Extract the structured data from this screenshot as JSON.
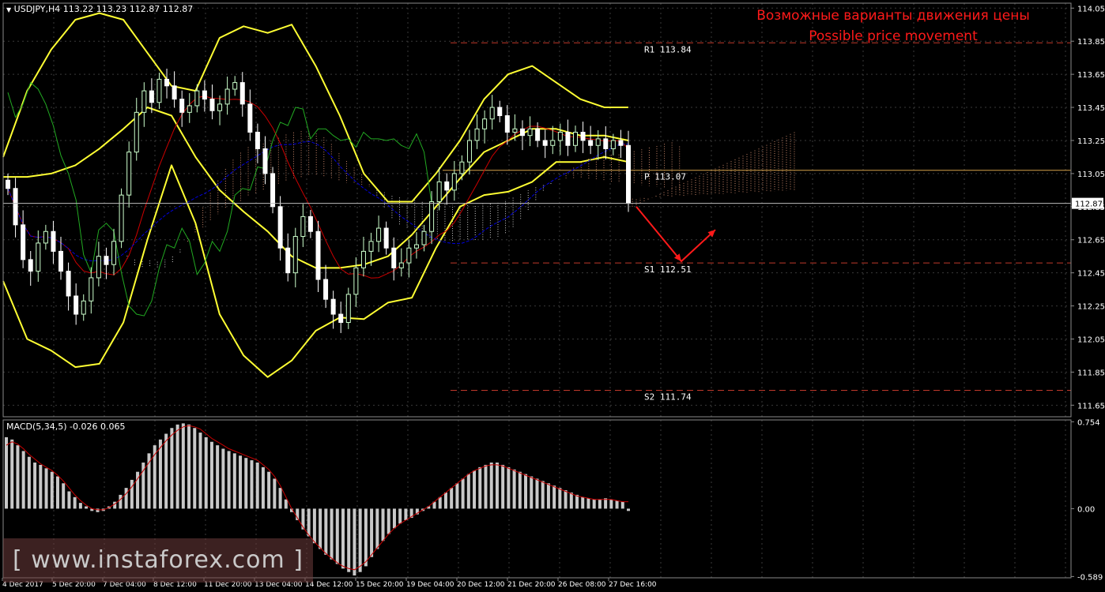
{
  "header": {
    "symbol_line": "USDJPY,H4  113.22 113.23 112.87 112.87",
    "macd_line": "MACD(5,34,5) -0.026 0.065"
  },
  "annotation": {
    "line1": "Возможные варианты движения цены",
    "line2": "Possible price movement"
  },
  "watermark": "[ www.instaforex.com ]",
  "colors": {
    "background": "#000000",
    "grid": "#3a3a3a",
    "bull_candle": "#ccffcc",
    "bear_candle": "#ffffff",
    "bollinger": "#ffff33",
    "tenkan": "#cc0000",
    "kijun": "#0000dd",
    "chikou": "#22aa22",
    "cloud_up": "#c9876a",
    "cloud_down": "#cccccc",
    "pivot": "#d4a24a",
    "levels": "#c0392b",
    "macd_hist": "#c8c8c8",
    "macd_signal": "#cc0000",
    "arrow": "#ff1a1a"
  },
  "chart_data": {
    "type": "candlestick",
    "symbol": "USDJPY",
    "timeframe": "H4",
    "ohlc_header": {
      "open": 113.22,
      "high": 113.23,
      "low": 112.87,
      "close": 112.87
    },
    "price_axis": {
      "range": [
        111.58,
        114.08
      ],
      "ticks": [
        "114.05",
        "113.85",
        "113.65",
        "113.45",
        "113.25",
        "113.05",
        "112.85",
        "112.65",
        "112.45",
        "112.25",
        "112.05",
        "111.85",
        "111.65"
      ],
      "current_price": "112.87"
    },
    "time_axis": {
      "labels": [
        "4 Dec 2017",
        "5 Dec 20:00",
        "7 Dec 04:00",
        "8 Dec 12:00",
        "11 Dec 20:00",
        "13 Dec 04:00",
        "14 Dec 12:00",
        "15 Dec 20:00",
        "19 Dec 04:00",
        "20 Dec 12:00",
        "21 Dec 20:00",
        "26 Dec 08:00",
        "27 Dec 16:00"
      ]
    },
    "levels": [
      {
        "label": "R1 113.84",
        "value": 113.84
      },
      {
        "label": "P 113.07",
        "value": 113.07
      },
      {
        "label": "S1 112.51",
        "value": 112.51
      },
      {
        "label": "S2 111.74",
        "value": 111.74
      }
    ],
    "candle_closes": [
      112.96,
      112.74,
      112.53,
      112.46,
      112.63,
      112.7,
      112.58,
      112.46,
      112.31,
      112.2,
      112.28,
      112.42,
      112.55,
      112.5,
      112.64,
      112.92,
      113.18,
      113.42,
      113.55,
      113.48,
      113.62,
      113.58,
      113.5,
      113.42,
      113.46,
      113.55,
      113.5,
      113.43,
      113.47,
      113.56,
      113.6,
      113.47,
      113.3,
      113.2,
      113.05,
      112.85,
      112.6,
      112.45,
      112.67,
      112.79,
      112.7,
      112.41,
      112.29,
      112.2,
      112.15,
      112.32,
      112.48,
      112.58,
      112.64,
      112.72,
      112.6,
      112.48,
      112.51,
      112.6,
      112.62,
      112.7,
      112.88,
      113.0,
      112.95,
      113.05,
      113.12,
      113.25,
      113.32,
      113.38,
      113.45,
      113.4,
      113.3,
      113.32,
      113.28,
      113.32,
      113.25,
      113.22,
      113.25,
      113.3,
      113.22,
      113.3,
      113.25,
      113.22,
      113.26,
      113.2,
      113.25,
      113.22,
      112.87
    ],
    "bollinger": {
      "upper": [
        113.15,
        113.55,
        113.8,
        113.98,
        114.02,
        113.98,
        113.78,
        113.58,
        113.55,
        113.87,
        113.94,
        113.9,
        113.95,
        113.7,
        113.4,
        113.05,
        112.88,
        112.88,
        113.05,
        113.25,
        113.5,
        113.65,
        113.7,
        113.6,
        113.5,
        113.45,
        113.45
      ],
      "middle": [
        113.03,
        113.03,
        113.05,
        113.1,
        113.2,
        113.32,
        113.45,
        113.4,
        113.15,
        112.95,
        112.82,
        112.7,
        112.55,
        112.48,
        112.48,
        112.5,
        112.55,
        112.68,
        112.85,
        113.02,
        113.18,
        113.25,
        113.32,
        113.32,
        113.28,
        113.28,
        113.25
      ],
      "lower": [
        112.4,
        112.05,
        111.98,
        111.88,
        111.9,
        112.15,
        112.65,
        113.1,
        112.75,
        112.2,
        111.95,
        111.82,
        111.92,
        112.1,
        112.18,
        112.17,
        112.27,
        112.3,
        112.6,
        112.85,
        112.92,
        112.94,
        113.0,
        113.12,
        113.12,
        113.15,
        113.12
      ]
    },
    "macd": {
      "axis_ticks": [
        "0.754",
        "0.00",
        "-0.589"
      ],
      "range": [
        -0.6,
        0.77
      ],
      "histogram": [
        0.62,
        0.6,
        0.55,
        0.5,
        0.45,
        0.4,
        0.38,
        0.35,
        0.32,
        0.28,
        0.22,
        0.15,
        0.1,
        0.05,
        0.02,
        -0.02,
        -0.03,
        -0.02,
        0.02,
        0.06,
        0.12,
        0.18,
        0.25,
        0.32,
        0.4,
        0.48,
        0.55,
        0.6,
        0.65,
        0.7,
        0.73,
        0.74,
        0.73,
        0.7,
        0.66,
        0.62,
        0.58,
        0.55,
        0.52,
        0.5,
        0.48,
        0.46,
        0.44,
        0.42,
        0.4,
        0.36,
        0.32,
        0.26,
        0.18,
        0.08,
        -0.03,
        -0.1,
        -0.18,
        -0.24,
        -0.3,
        -0.35,
        -0.4,
        -0.44,
        -0.48,
        -0.52,
        -0.55,
        -0.58,
        -0.55,
        -0.5,
        -0.42,
        -0.35,
        -0.28,
        -0.22,
        -0.17,
        -0.13,
        -0.1,
        -0.08,
        -0.05,
        -0.02,
        0.02,
        0.06,
        0.1,
        0.14,
        0.18,
        0.22,
        0.26,
        0.3,
        0.33,
        0.36,
        0.38,
        0.4,
        0.4,
        0.38,
        0.36,
        0.34,
        0.32,
        0.3,
        0.28,
        0.26,
        0.24,
        0.22,
        0.2,
        0.18,
        0.16,
        0.14,
        0.12,
        0.1,
        0.09,
        0.08,
        0.08,
        0.09,
        0.08,
        0.07,
        0.06,
        -0.02
      ],
      "signal": [
        0.55,
        0.58,
        0.56,
        0.52,
        0.47,
        0.43,
        0.39,
        0.36,
        0.33,
        0.29,
        0.24,
        0.18,
        0.12,
        0.07,
        0.03,
        0.0,
        -0.01,
        -0.01,
        0.01,
        0.04,
        0.08,
        0.13,
        0.19,
        0.26,
        0.33,
        0.4,
        0.47,
        0.53,
        0.59,
        0.64,
        0.68,
        0.71,
        0.72,
        0.71,
        0.69,
        0.65,
        0.61,
        0.58,
        0.55,
        0.52,
        0.5,
        0.48,
        0.46,
        0.44,
        0.42,
        0.38,
        0.34,
        0.28,
        0.2,
        0.1,
        0.0,
        -0.08,
        -0.16,
        -0.23,
        -0.29,
        -0.34,
        -0.39,
        -0.43,
        -0.47,
        -0.5,
        -0.52,
        -0.53,
        -0.5,
        -0.46,
        -0.4,
        -0.34,
        -0.28,
        -0.22,
        -0.17,
        -0.13,
        -0.1,
        -0.07,
        -0.04,
        -0.01,
        0.02,
        0.06,
        0.1,
        0.14,
        0.18,
        0.22,
        0.26,
        0.3,
        0.33,
        0.35,
        0.37,
        0.38,
        0.38,
        0.37,
        0.35,
        0.33,
        0.31,
        0.29,
        0.27,
        0.25,
        0.23,
        0.21,
        0.19,
        0.17,
        0.15,
        0.13,
        0.11,
        0.1,
        0.09,
        0.08,
        0.08,
        0.08,
        0.08,
        0.07,
        0.06,
        0.06
      ]
    },
    "forecast_path": [
      112.85,
      112.52,
      112.71
    ]
  }
}
